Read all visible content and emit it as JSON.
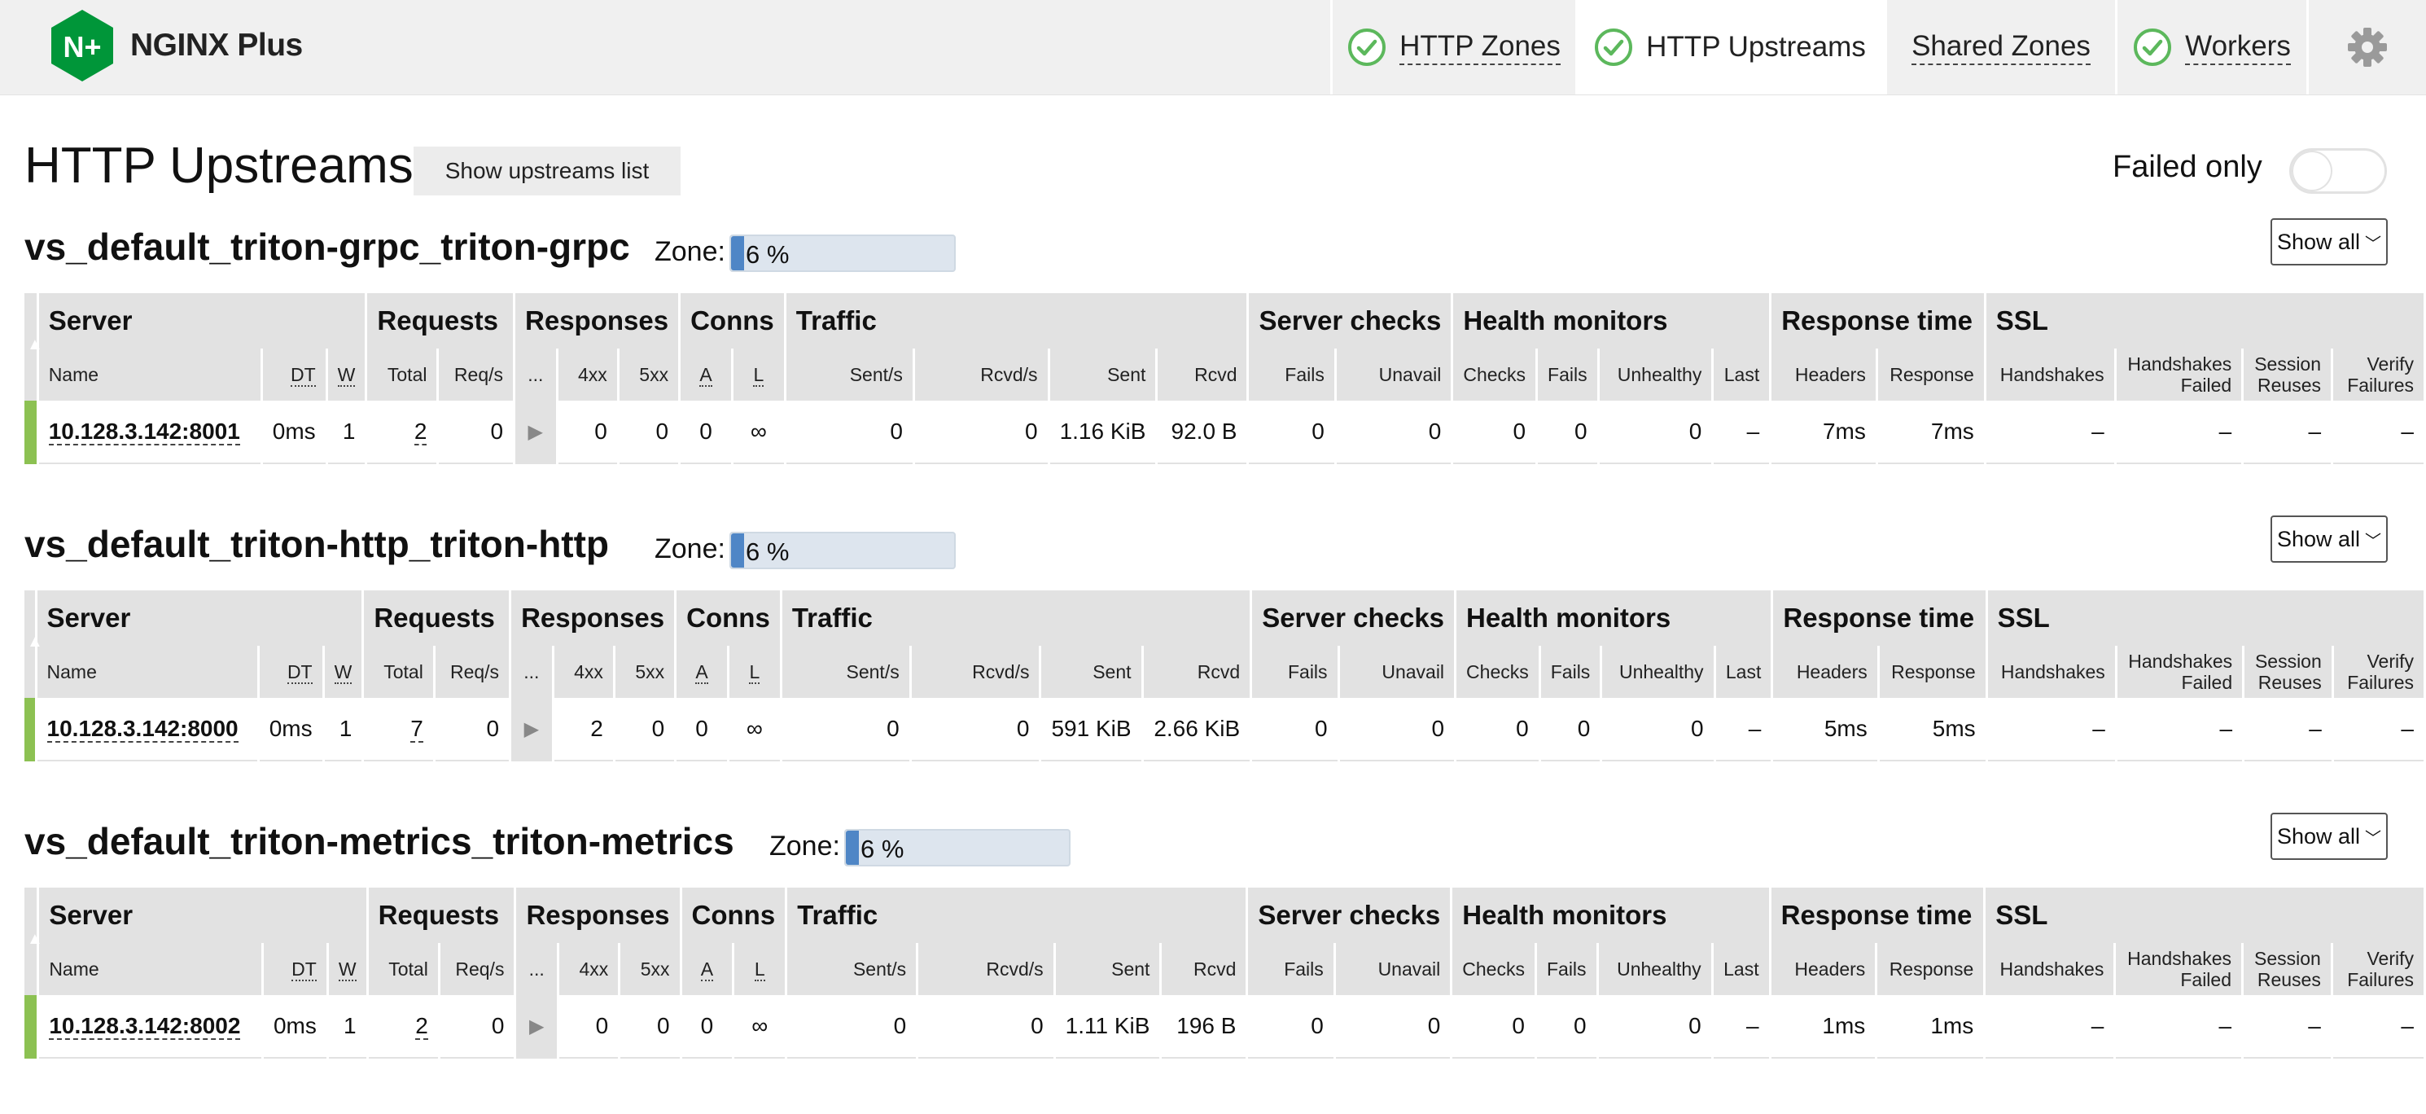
{
  "header": {
    "logo_text": "NGINX Plus",
    "logo_mark": "N+",
    "tabs": [
      {
        "label": "HTTP Zones",
        "status": "ok"
      },
      {
        "label": "HTTP Upstreams",
        "status": "ok",
        "active": true
      },
      {
        "label": "Shared Zones"
      },
      {
        "label": "Workers",
        "status": "ok"
      }
    ],
    "settings_icon": "gear-icon"
  },
  "page": {
    "title": "HTTP Upstreams",
    "show_list_label": "Show upstreams list",
    "failed_only_label": "Failed only",
    "failed_only_on": false
  },
  "colors": {
    "brand_green": "#009639",
    "status_up": "#8cc152",
    "zone_fill": "#4f86c6",
    "check_ok": "#5cb85c"
  },
  "columns": {
    "groups": [
      "Server",
      "Requests",
      "Responses",
      "Conns",
      "Traffic",
      "Server checks",
      "Health monitors",
      "Response time",
      "SSL"
    ],
    "sub": {
      "name": "Name",
      "dt": "DT",
      "w": "W",
      "total": "Total",
      "req_s": "Req/s",
      "ellipsis": "...",
      "r4xx": "4xx",
      "r5xx": "5xx",
      "a": "A",
      "l": "L",
      "sent_s": "Sent/s",
      "rcvd_s": "Rcvd/s",
      "sent": "Sent",
      "rcvd": "Rcvd",
      "fails": "Fails",
      "unavail": "Unavail",
      "checks": "Checks",
      "hm_fails": "Fails",
      "unhealthy": "Unhealthy",
      "last": "Last",
      "headers": "Headers",
      "response": "Response",
      "handshakes": "Handshakes",
      "handshakes_failed_1": "Handshakes",
      "handshakes_failed_2": "Failed",
      "session_1": "Session",
      "session_2": "Reuses",
      "verify_1": "Verify",
      "verify_2": "Failures"
    }
  },
  "upstreams": [
    {
      "name": "vs_default_triton-grpc_triton-grpc",
      "zone_label": "Zone:",
      "zone_percent": 6,
      "zone_text": "6 %",
      "show_label": "Show all",
      "server": {
        "name": "10.128.3.142:8001",
        "dt": "0ms",
        "w": "1",
        "total": "2",
        "req_s": "0",
        "r4xx": "0",
        "r5xx": "0",
        "a": "0",
        "l": "∞",
        "sent_s": "0",
        "rcvd_s": "0",
        "sent": "1.16 KiB",
        "rcvd": "92.0 B",
        "fails": "0",
        "unavail": "0",
        "checks": "0",
        "hm_fails": "0",
        "unhealthy": "0",
        "last": "–",
        "headers": "7ms",
        "response": "7ms",
        "handshakes": "–",
        "handshakes_failed": "–",
        "session_reuses": "–",
        "verify_failures": "–"
      }
    },
    {
      "name": "vs_default_triton-http_triton-http",
      "zone_label": "Zone:",
      "zone_percent": 6,
      "zone_text": "6 %",
      "show_label": "Show all",
      "server": {
        "name": "10.128.3.142:8000",
        "dt": "0ms",
        "w": "1",
        "total": "7",
        "req_s": "0",
        "r4xx": "2",
        "r5xx": "0",
        "a": "0",
        "l": "∞",
        "sent_s": "0",
        "rcvd_s": "0",
        "sent": "591 KiB",
        "rcvd": "2.66 KiB",
        "fails": "0",
        "unavail": "0",
        "checks": "0",
        "hm_fails": "0",
        "unhealthy": "0",
        "last": "–",
        "headers": "5ms",
        "response": "5ms",
        "handshakes": "–",
        "handshakes_failed": "–",
        "session_reuses": "–",
        "verify_failures": "–"
      }
    },
    {
      "name": "vs_default_triton-metrics_triton-metrics",
      "zone_label": "Zone:",
      "zone_percent": 6,
      "zone_text": "6 %",
      "show_label": "Show all",
      "server": {
        "name": "10.128.3.142:8002",
        "dt": "0ms",
        "w": "1",
        "total": "2",
        "req_s": "0",
        "r4xx": "0",
        "r5xx": "0",
        "a": "0",
        "l": "∞",
        "sent_s": "0",
        "rcvd_s": "0",
        "sent": "1.11 KiB",
        "rcvd": "196 B",
        "fails": "0",
        "unavail": "0",
        "checks": "0",
        "hm_fails": "0",
        "unhealthy": "0",
        "last": "–",
        "headers": "1ms",
        "response": "1ms",
        "handshakes": "–",
        "handshakes_failed": "–",
        "session_reuses": "–",
        "verify_failures": "–"
      }
    }
  ]
}
